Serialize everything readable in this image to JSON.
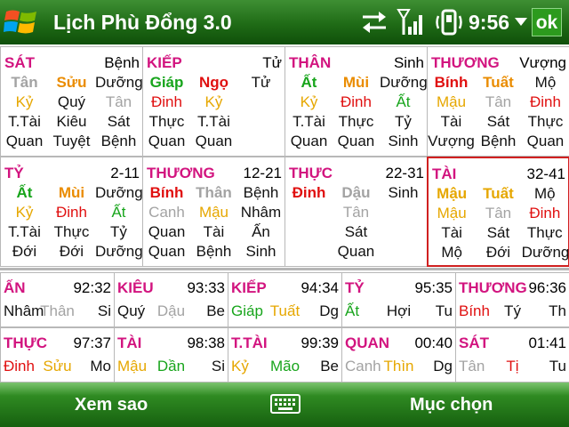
{
  "titlebar": {
    "app_title": "Lịch Phù Đổng 3.0",
    "time": "9:56",
    "ok_label": "ok",
    "icons": [
      "windows-start-icon",
      "sync-arrows-icon",
      "signal-strength-icon",
      "phone-vibrate-icon",
      "dropdown-caret-icon"
    ]
  },
  "palace_rows": [
    [
      {
        "title": "SÁT",
        "title_color": "#d2147f",
        "corner": "Bệnh",
        "selected": false,
        "rows": [
          [
            [
              "Tân",
              "#a3a3a3",
              true
            ],
            [
              "Sửu",
              "#ea8c00",
              true
            ],
            [
              "Dưỡng",
              "#111111",
              false
            ]
          ],
          [
            [
              "Kỷ",
              "#e6a700",
              false
            ],
            [
              "Quý",
              "#111111",
              false
            ],
            [
              "Tân",
              "#a3a3a3",
              false
            ]
          ],
          [
            [
              "T.Tài",
              "#111111",
              false
            ],
            [
              "Kiêu",
              "#111111",
              false
            ],
            [
              "Sát",
              "#111111",
              false
            ]
          ],
          [
            [
              "Quan",
              "#111111",
              false
            ],
            [
              "Tuyệt",
              "#111111",
              false
            ],
            [
              "Bệnh",
              "#111111",
              false
            ]
          ]
        ]
      },
      {
        "title": "KIẾP",
        "title_color": "#d2147f",
        "corner": "Tử",
        "selected": false,
        "rows": [
          [
            [
              "Giáp",
              "#18a51c",
              true
            ],
            [
              "Ngọ",
              "#e01010",
              true
            ],
            [
              "Tử",
              "#111111",
              false
            ]
          ],
          [
            [
              "Đinh",
              "#e01010",
              false
            ],
            [
              "Kỷ",
              "#e6a700",
              false
            ],
            [
              "",
              null,
              false
            ]
          ],
          [
            [
              "Thực",
              "#111111",
              false
            ],
            [
              "T.Tài",
              "#111111",
              false
            ],
            [
              "",
              null,
              false
            ]
          ],
          [
            [
              "Quan",
              "#111111",
              false
            ],
            [
              "Quan",
              "#111111",
              false
            ],
            [
              "",
              null,
              false
            ]
          ]
        ]
      },
      {
        "title": "THÂN",
        "title_color": "#d2147f",
        "corner": "Sinh",
        "selected": false,
        "rows": [
          [
            [
              "Ất",
              "#18a51c",
              true
            ],
            [
              "Mùi",
              "#ea8c00",
              true
            ],
            [
              "Dưỡng",
              "#111111",
              false
            ]
          ],
          [
            [
              "Kỷ",
              "#e6a700",
              false
            ],
            [
              "Đinh",
              "#e01010",
              false
            ],
            [
              "Ất",
              "#18a51c",
              false
            ]
          ],
          [
            [
              "T.Tài",
              "#111111",
              false
            ],
            [
              "Thực",
              "#111111",
              false
            ],
            [
              "Tỷ",
              "#111111",
              false
            ]
          ],
          [
            [
              "Quan",
              "#111111",
              false
            ],
            [
              "Quan",
              "#111111",
              false
            ],
            [
              "Sinh",
              "#111111",
              false
            ]
          ]
        ]
      },
      {
        "title": "THƯƠNG",
        "title_color": "#d2147f",
        "corner": "Vượng",
        "selected": false,
        "rows": [
          [
            [
              "Bính",
              "#e01010",
              true
            ],
            [
              "Tuất",
              "#ea8c00",
              true
            ],
            [
              "Mộ",
              "#111111",
              false
            ]
          ],
          [
            [
              "Mậu",
              "#e6a700",
              false
            ],
            [
              "Tân",
              "#a3a3a3",
              false
            ],
            [
              "Đinh",
              "#e01010",
              false
            ]
          ],
          [
            [
              "Tài",
              "#111111",
              false
            ],
            [
              "Sát",
              "#111111",
              false
            ],
            [
              "Thực",
              "#111111",
              false
            ]
          ],
          [
            [
              "Vượng",
              "#111111",
              false
            ],
            [
              "Bệnh",
              "#111111",
              false
            ],
            [
              "Quan",
              "#111111",
              false
            ]
          ]
        ]
      }
    ],
    [
      {
        "title": "TỶ",
        "title_color": "#d2147f",
        "corner": "2-11",
        "selected": false,
        "rows": [
          [
            [
              "Ất",
              "#18a51c",
              true
            ],
            [
              "Mùi",
              "#ea8c00",
              true
            ],
            [
              "Dưỡng",
              "#111111",
              false
            ]
          ],
          [
            [
              "Kỷ",
              "#e6a700",
              false
            ],
            [
              "Đinh",
              "#e01010",
              false
            ],
            [
              "Ất",
              "#18a51c",
              false
            ]
          ],
          [
            [
              "T.Tài",
              "#111111",
              false
            ],
            [
              "Thực",
              "#111111",
              false
            ],
            [
              "Tỷ",
              "#111111",
              false
            ]
          ],
          [
            [
              "Đới",
              "#111111",
              false
            ],
            [
              "Đới",
              "#111111",
              false
            ],
            [
              "Dưỡng",
              "#111111",
              false
            ]
          ]
        ]
      },
      {
        "title": "THƯƠNG",
        "title_color": "#d2147f",
        "corner": "12-21",
        "selected": false,
        "rows": [
          [
            [
              "Bính",
              "#e01010",
              true
            ],
            [
              "Thân",
              "#a3a3a3",
              true
            ],
            [
              "Bệnh",
              "#111111",
              false
            ]
          ],
          [
            [
              "Canh",
              "#a3a3a3",
              false
            ],
            [
              "Mậu",
              "#e6a700",
              false
            ],
            [
              "Nhâm",
              "#111111",
              false
            ]
          ],
          [
            [
              "Quan",
              "#111111",
              false
            ],
            [
              "Tài",
              "#111111",
              false
            ],
            [
              "Ấn",
              "#111111",
              false
            ]
          ],
          [
            [
              "Quan",
              "#111111",
              false
            ],
            [
              "Bệnh",
              "#111111",
              false
            ],
            [
              "Sinh",
              "#111111",
              false
            ]
          ]
        ]
      },
      {
        "title": "THỰC",
        "title_color": "#d2147f",
        "corner": "22-31",
        "selected": false,
        "rows": [
          [
            [
              "Đinh",
              "#e01010",
              true
            ],
            [
              "Dậu",
              "#a3a3a3",
              true
            ],
            [
              "Sinh",
              "#111111",
              false
            ]
          ],
          [
            [
              "",
              null,
              false
            ],
            [
              "Tân",
              "#a3a3a3",
              false
            ],
            [
              "",
              null,
              false
            ]
          ],
          [
            [
              "",
              null,
              false
            ],
            [
              "Sát",
              "#111111",
              false
            ],
            [
              "",
              null,
              false
            ]
          ],
          [
            [
              "",
              null,
              false
            ],
            [
              "Quan",
              "#111111",
              false
            ],
            [
              "",
              null,
              false
            ]
          ]
        ]
      },
      {
        "title": "TÀI",
        "title_color": "#d2147f",
        "corner": "32-41",
        "selected": true,
        "rows": [
          [
            [
              "Mậu",
              "#e6a700",
              true
            ],
            [
              "Tuất",
              "#e6a700",
              true
            ],
            [
              "Mộ",
              "#111111",
              false
            ]
          ],
          [
            [
              "Mậu",
              "#e6a700",
              false
            ],
            [
              "Tân",
              "#a3a3a3",
              false
            ],
            [
              "Đinh",
              "#e01010",
              false
            ]
          ],
          [
            [
              "Tài",
              "#111111",
              false
            ],
            [
              "Sát",
              "#111111",
              false
            ],
            [
              "Thực",
              "#111111",
              false
            ]
          ],
          [
            [
              "Mộ",
              "#111111",
              false
            ],
            [
              "Đới",
              "#111111",
              false
            ],
            [
              "Dưỡng",
              "#111111",
              false
            ]
          ]
        ]
      }
    ]
  ],
  "luck_rows": [
    [
      {
        "title": "ẤN",
        "age": "92:32",
        "items": [
          [
            "Nhâm",
            "#111111"
          ],
          [
            "Thân",
            "#a3a3a3"
          ],
          [
            "Si",
            "#111111"
          ]
        ]
      },
      {
        "title": "KIÊU",
        "age": "93:33",
        "items": [
          [
            "Quý",
            "#111111"
          ],
          [
            "Dậu",
            "#a3a3a3"
          ],
          [
            "Be",
            "#111111"
          ]
        ]
      },
      {
        "title": "KIẾP",
        "age": "94:34",
        "items": [
          [
            "Giáp",
            "#18a51c"
          ],
          [
            "Tuất",
            "#e6a700"
          ],
          [
            "Dg",
            "#111111"
          ]
        ]
      },
      {
        "title": "TỶ",
        "age": "95:35",
        "items": [
          [
            "Ất",
            "#18a51c"
          ],
          [
            "Hợi",
            "#111111"
          ],
          [
            "Tu",
            "#111111"
          ]
        ]
      },
      {
        "title": "THƯƠNG",
        "age": "96:36",
        "items": [
          [
            "Bính",
            "#e01010"
          ],
          [
            "Tý",
            "#111111"
          ],
          [
            "Th",
            "#111111"
          ]
        ]
      }
    ],
    [
      {
        "title": "THỰC",
        "age": "97:37",
        "items": [
          [
            "Đinh",
            "#e01010"
          ],
          [
            "Sửu",
            "#e6a700"
          ],
          [
            "Mo",
            "#111111"
          ]
        ]
      },
      {
        "title": "TÀI",
        "age": "98:38",
        "items": [
          [
            "Mậu",
            "#e6a700"
          ],
          [
            "Dần",
            "#18a51c"
          ],
          [
            "Si",
            "#111111"
          ]
        ]
      },
      {
        "title": "T.TÀI",
        "age": "99:39",
        "items": [
          [
            "Kỷ",
            "#e6a700"
          ],
          [
            "Mão",
            "#18a51c"
          ],
          [
            "Be",
            "#111111"
          ]
        ]
      },
      {
        "title": "QUAN",
        "age": "00:40",
        "items": [
          [
            "Canh",
            "#a3a3a3"
          ],
          [
            "Thìn",
            "#e6a700"
          ],
          [
            "Dg",
            "#111111"
          ]
        ]
      },
      {
        "title": "SÁT",
        "age": "01:41",
        "items": [
          [
            "Tân",
            "#a3a3a3"
          ],
          [
            "Tị",
            "#e01010"
          ],
          [
            "Tu",
            "#111111"
          ]
        ]
      }
    ]
  ],
  "menubar": {
    "left_label": "Xem sao",
    "right_label": "Mục chọn",
    "center_icon": "keyboard-icon"
  }
}
